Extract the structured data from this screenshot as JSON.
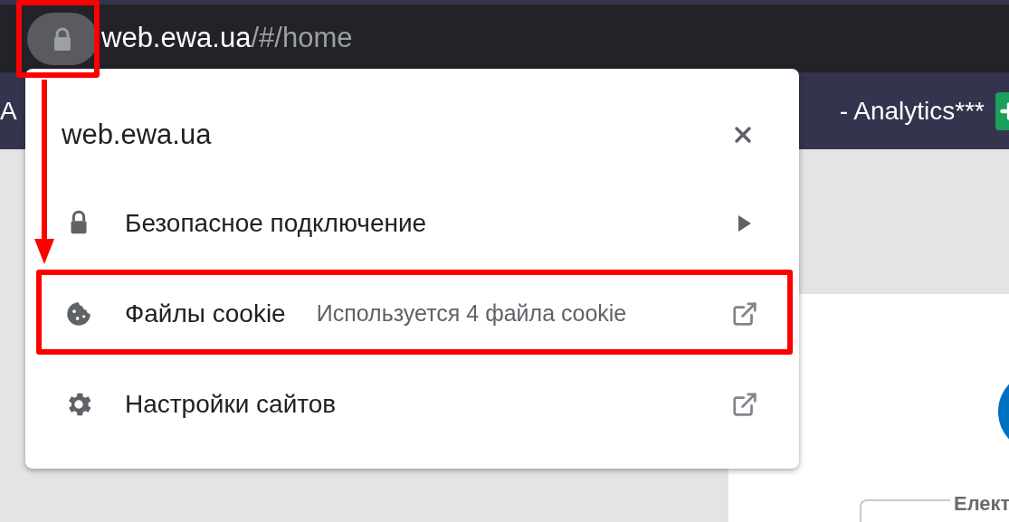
{
  "address_bar": {
    "host": "web.ewa.ua",
    "path": "/#/home",
    "highlighted": true
  },
  "bookmarks": [
    {
      "label": "A"
    },
    {
      "label": "- Analytics***"
    }
  ],
  "popup": {
    "title": "web.ewa.ua",
    "items": [
      {
        "kind": "submenu",
        "label": "Безопасное подключение",
        "highlighted": false
      },
      {
        "kind": "external",
        "label": "Файлы cookie",
        "detail": "Используется 4 файла cookie",
        "highlighted": true
      },
      {
        "kind": "external",
        "label": "Настройки сайтов",
        "highlighted": false
      }
    ]
  },
  "page": {
    "legend": "Елект"
  }
}
